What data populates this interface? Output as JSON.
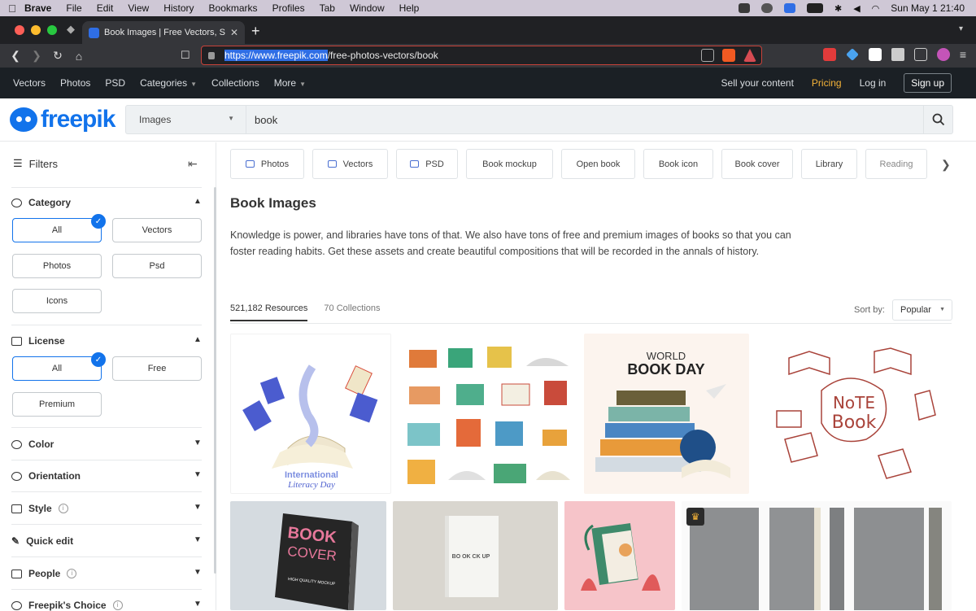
{
  "macos": {
    "app_name": "Brave",
    "menus": [
      "File",
      "Edit",
      "View",
      "History",
      "Bookmarks",
      "Profiles",
      "Tab",
      "Window",
      "Help"
    ],
    "clock": "Sun May 1  21:40"
  },
  "browser": {
    "tab_title": "Book Images | Free Vectors, Stock",
    "url_scheme_host": "https://www.freepik.com",
    "url_path": "/free-photos-vectors/book",
    "shield_count": "5"
  },
  "site_nav": {
    "items": [
      "Vectors",
      "Photos",
      "PSD",
      "Categories",
      "Collections",
      "More"
    ],
    "sell": "Sell your content",
    "pricing": "Pricing",
    "login": "Log in",
    "signup": "Sign up"
  },
  "header": {
    "logo": "freepik",
    "search_type": "Images",
    "search_query": "book"
  },
  "sidebar": {
    "title": "Filters",
    "category": {
      "label": "Category",
      "options": [
        "All",
        "Vectors",
        "Photos",
        "Psd",
        "Icons"
      ],
      "selected": "All"
    },
    "license": {
      "label": "License",
      "options": [
        "All",
        "Free",
        "Premium"
      ],
      "selected": "All"
    },
    "sections": [
      "Color",
      "Orientation",
      "Style",
      "Quick edit",
      "People",
      "Freepik's Choice"
    ]
  },
  "main": {
    "chips": [
      "Photos",
      "Vectors",
      "PSD",
      "Book mockup",
      "Open book",
      "Book icon",
      "Book cover",
      "Library",
      "Reading"
    ],
    "title": "Book Images",
    "description": "Knowledge is power, and libraries have tons of that. We also have tons of free and premium images of books so that you can foster reading habits. Get these assets and create beautiful compositions that will be recorded in the annals of history.",
    "tab_resources": "521,182 Resources",
    "tab_collections": "70 Collections",
    "sort_label": "Sort by:",
    "sort_value": "Popular"
  },
  "images": {
    "literacy_caption_1": "International",
    "literacy_caption_2": "Literacy Day",
    "world": "WORLD",
    "book_day": "BOOK DAY",
    "note": "NoTE",
    "book_word": "Book",
    "cover_book": "BOOK",
    "cover_cover": "COVER",
    "cover_sub": "HIGH QUALITY MOCKUP",
    "mockup_text": "BO OK CK UP"
  },
  "colors": {
    "brand_blue": "#1273eb",
    "pricing_orange": "#f5b338",
    "nav_bg": "#1b2025"
  }
}
